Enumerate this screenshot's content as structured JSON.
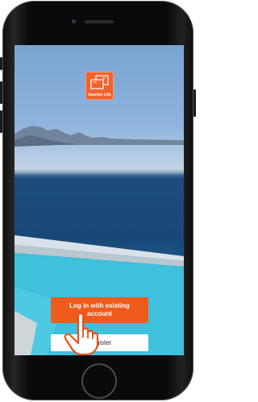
{
  "app": {
    "name": "Inverter Life"
  },
  "actions": {
    "login_label": "Log in with existing account",
    "register_label": "Register"
  },
  "icons": {
    "logo": "inverter-life-logo-icon",
    "pointer": "pointing-hand-icon"
  },
  "colors": {
    "accent": "#ef5b1c",
    "logo_bg": "#f2622c",
    "register_bg": "#ffffff"
  }
}
